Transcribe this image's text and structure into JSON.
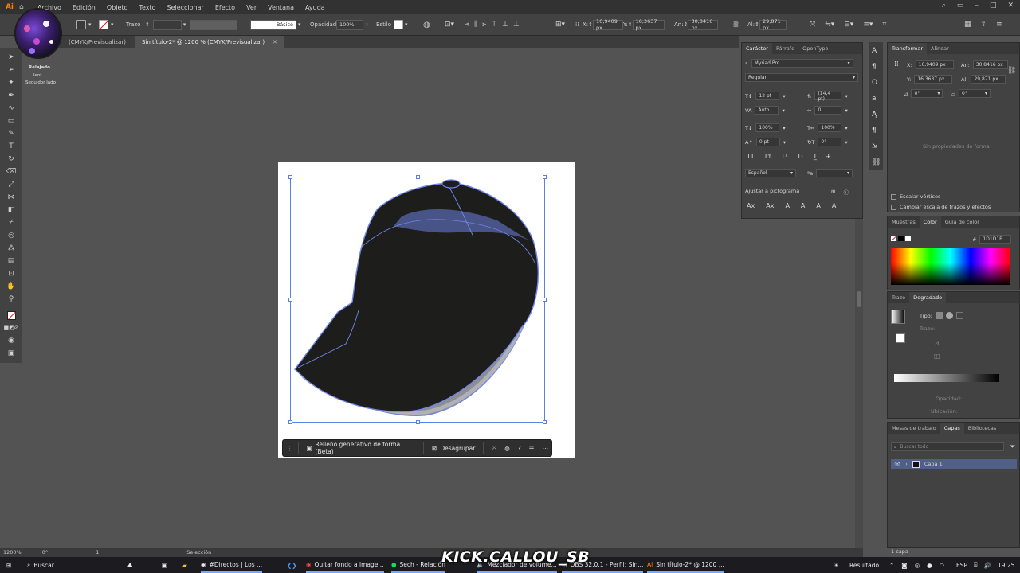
{
  "menu": {
    "items": [
      "Archivo",
      "Edición",
      "Objeto",
      "Texto",
      "Seleccionar",
      "Efecto",
      "Ver",
      "Ventana",
      "Ayuda"
    ]
  },
  "avatar": {
    "name_label": "Relajado",
    "sub_label": "Seguidor lado",
    "status": "lent"
  },
  "control_bar": {
    "stroke_label": "Trazo",
    "stroke_style": "Básico",
    "opacity_label": "Opacidad",
    "opacity_value": "100%",
    "style_label": "Estilo",
    "x_label": "X:",
    "x_value": "16,9409 px",
    "y_label": "Y:",
    "y_value": "16,3637 px",
    "w_label": "An:",
    "w_value": "30,8416 px",
    "h_label": "Al:",
    "h_value": "29,871 px"
  },
  "tabs": [
    {
      "label": "(CMYK/Previsualizar)",
      "active": false
    },
    {
      "label": "Sin título-2* @ 1200 % (CMYK/Previsualizar)",
      "active": true
    }
  ],
  "character_panel": {
    "tabs": [
      "Carácter",
      "Párrafo",
      "OpenType"
    ],
    "font_family": "Myriad Pro",
    "font_style": "Regular",
    "size": "12 pt",
    "leading": "(14,4 pt)",
    "kerning": "Auto",
    "tracking": "0",
    "vscale": "100%",
    "hscale": "100%",
    "baseline": "0 pt",
    "rotation": "0°",
    "language": "Español",
    "snap_label": "Ajustar a pictograma"
  },
  "transform_panel": {
    "tabs": [
      "Transformar",
      "Alinear"
    ],
    "x_label": "X:",
    "x_value": "16,9409 px",
    "y_label": "Y:",
    "y_value": "16,3637 px",
    "w_label": "An:",
    "w_value": "30,8416 px",
    "h_label": "Al:",
    "h_value": "29,871 px",
    "angle": "0°",
    "shear": "0°",
    "no_props": "Sin propiedades de forma",
    "scale_corners": "Escalar vértices",
    "scale_strokes": "Cambiar escala de trazos y efectos"
  },
  "color_panel": {
    "tabs": [
      "Muestras",
      "Color",
      "Guía de color"
    ],
    "hex": "1D1D1B"
  },
  "gradient_panel": {
    "tabs": [
      "Trazo",
      "Degradado"
    ],
    "type_label": "Tipo:",
    "stroke_label": "Trazo:",
    "opacity_label": "Opacidad:",
    "location_label": "Ubicación:"
  },
  "layers_panel": {
    "tabs": [
      "Mesas de trabajo",
      "Capas",
      "Bibliotecas"
    ],
    "search_placeholder": "Buscar todo",
    "layer_name": "Capa 1",
    "count_label": "1 capa"
  },
  "context_bar": {
    "generative_label": "Relleno generativo de forma (Beta)",
    "ungroup_label": "Desagrupar"
  },
  "status_bar": {
    "zoom": "1200%",
    "rotation": "0°",
    "page": "1",
    "tool": "Selección"
  },
  "taskbar": {
    "search_label": "Buscar",
    "items": [
      "#Directos | Los ...",
      "Quitar fondo a image...",
      "Sech - Relación",
      "Mezclador de volume...",
      "OBS 32.0.1 - Perfil: Sin...",
      "Sin título-2* @ 1200 ..."
    ],
    "weather": "Resultado",
    "lang": "ESP",
    "time": "19:25"
  },
  "watermark": "KICK.CALLOU_SB",
  "colors": {
    "accent": "#5a7fe8",
    "cap_fill": "#1d1d1b",
    "menu_bg": "#323232",
    "panel_bg": "#424242"
  }
}
